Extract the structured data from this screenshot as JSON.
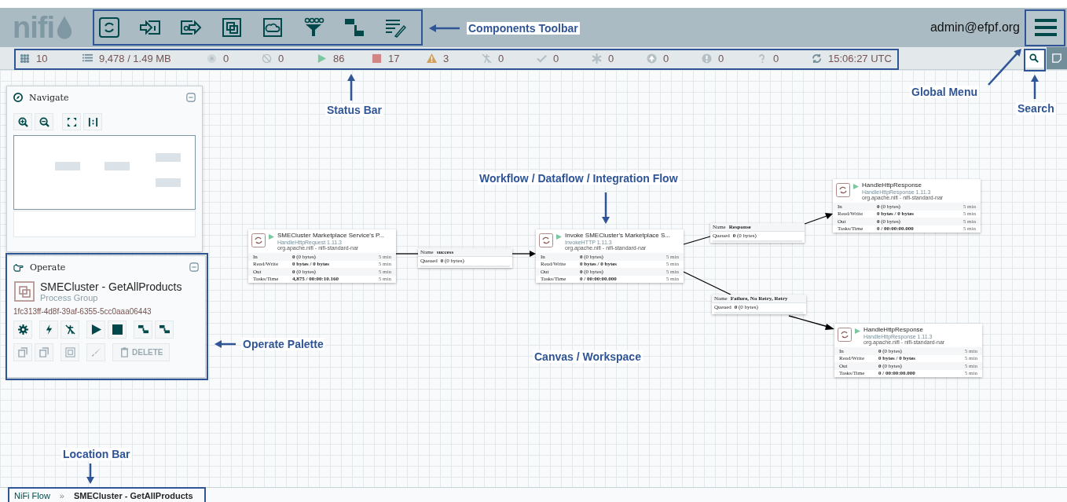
{
  "header": {
    "logo": "nifi",
    "user": "admin@efpf.org"
  },
  "status_bar": [
    {
      "kind": "cluster",
      "value": "10"
    },
    {
      "kind": "queue",
      "value": "9,478 / 1.49 MB"
    },
    {
      "kind": "transmitting",
      "value": "0"
    },
    {
      "kind": "not-transmitting",
      "value": "0"
    },
    {
      "kind": "running",
      "value": "86"
    },
    {
      "kind": "stopped",
      "value": "17"
    },
    {
      "kind": "invalid",
      "value": "3"
    },
    {
      "kind": "disabled",
      "value": "0"
    },
    {
      "kind": "up-to-date",
      "value": "0"
    },
    {
      "kind": "modified",
      "value": "0"
    },
    {
      "kind": "stale",
      "value": "0"
    },
    {
      "kind": "errors",
      "value": "0"
    },
    {
      "kind": "sync-failure",
      "value": "0"
    },
    {
      "kind": "refresh",
      "value": "15:06:27 UTC"
    }
  ],
  "navigate": {
    "title": "Navigate"
  },
  "operate": {
    "title": "Operate",
    "name": "SMECluster - GetAllProducts",
    "type": "Process Group",
    "id": "1fc313ff-4d8f-39af-6355-5cc0aaa06443",
    "actions": [
      {
        "kind": "configure",
        "disabled": false
      },
      {
        "kind": "enable",
        "disabled": false
      },
      {
        "kind": "disable",
        "disabled": false
      },
      {
        "kind": "start",
        "disabled": false
      },
      {
        "kind": "stop",
        "disabled": false
      },
      {
        "kind": "create-template",
        "disabled": false
      },
      {
        "kind": "upload-template",
        "disabled": false
      }
    ],
    "actions_2": [
      {
        "kind": "copy",
        "disabled": true
      },
      {
        "kind": "paste",
        "disabled": true
      },
      {
        "kind": "group",
        "disabled": true
      },
      {
        "kind": "color",
        "disabled": true
      },
      {
        "kind": "delete",
        "disabled": true,
        "label": "DELETE"
      }
    ]
  },
  "processors": [
    {
      "name": "SMECluster Marketplace Service's P...",
      "type": "HandleHttpRequest 1.11.3",
      "bundle": "org.apache.nifi - nifi-standard-nar",
      "running": true,
      "stats": [
        {
          "label": "In",
          "value": "**0** (0 bytes)",
          "window": "5 min"
        },
        {
          "label": "Read/Write",
          "value": "0 bytes / 0 bytes",
          "window": "5 min"
        },
        {
          "label": "Out",
          "value": "**0** (0 bytes)",
          "window": "5 min"
        },
        {
          "label": "Tasks/Time",
          "value": "4,875 / 00:00:10.160",
          "window": "5 min"
        }
      ]
    },
    {
      "name": "Invoke SMECluster's Marketplace S...",
      "type": "InvokeHTTP 1.11.3",
      "bundle": "org.apache.nifi - nifi-standard-nar",
      "running": true,
      "stats": [
        {
          "label": "In",
          "value": "**0** (0 bytes)",
          "window": "5 min"
        },
        {
          "label": "Read/Write",
          "value": "0 bytes / 0 bytes",
          "window": "5 min"
        },
        {
          "label": "Out",
          "value": "**0** (0 bytes)",
          "window": "5 min"
        },
        {
          "label": "Tasks/Time",
          "value": "0 / 00:00:00.000",
          "window": "5 min"
        }
      ]
    },
    {
      "name": "HandleHttpResponse",
      "type": "HandleHttpResponse 1.11.3",
      "bundle": "org.apache.nifi - nifi-standard-nar",
      "running": true,
      "stats": [
        {
          "label": "In",
          "value": "**0** (0 bytes)",
          "window": "5 min"
        },
        {
          "label": "Read/Write",
          "value": "0 bytes / 0 bytes",
          "window": "5 min"
        },
        {
          "label": "Out",
          "value": "**0** (0 bytes)",
          "window": "5 min"
        },
        {
          "label": "Tasks/Time",
          "value": "0 / 00:00:00.000",
          "window": "5 min"
        }
      ]
    },
    {
      "name": "HandleHttpResponse",
      "type": "HandleHttpResponse 1.11.3",
      "bundle": "org.apache.nifi - nifi-standard-nar",
      "running": true,
      "stats": [
        {
          "label": "In",
          "value": "**0** (0 bytes)",
          "window": "5 min"
        },
        {
          "label": "Read/Write",
          "value": "0 bytes / 0 bytes",
          "window": "5 min"
        },
        {
          "label": "Out",
          "value": "**0** (0 bytes)",
          "window": "5 min"
        },
        {
          "label": "Tasks/Time",
          "value": "0 / 00:00:00.000",
          "window": "5 min"
        }
      ]
    }
  ],
  "connections": [
    {
      "name_label": "Name",
      "name": "success",
      "queued_label": "Queued",
      "queued": "**0** (0 bytes)"
    },
    {
      "name_label": "Name",
      "name": "Response",
      "queued_label": "Queued",
      "queued": "**0** (0 bytes)"
    },
    {
      "name_label": "Name",
      "name": "Failure, No Retry, Retry",
      "queued_label": "Queued",
      "queued": "**0** (0 bytes)"
    }
  ],
  "breadcrumbs": {
    "items": [
      "NiFi Flow",
      "SMECluster - GetAllProducts"
    ],
    "separator": "»"
  },
  "annotations": [
    {
      "label": "Components Toolbar"
    },
    {
      "label": "Status Bar"
    },
    {
      "label": "Global Menu"
    },
    {
      "label": "Search"
    },
    {
      "label": "Workflow / Dataflow / Integration Flow"
    },
    {
      "label": "Operate Palette"
    },
    {
      "label": "Canvas / Workspace"
    },
    {
      "label": "Location Bar"
    }
  ]
}
